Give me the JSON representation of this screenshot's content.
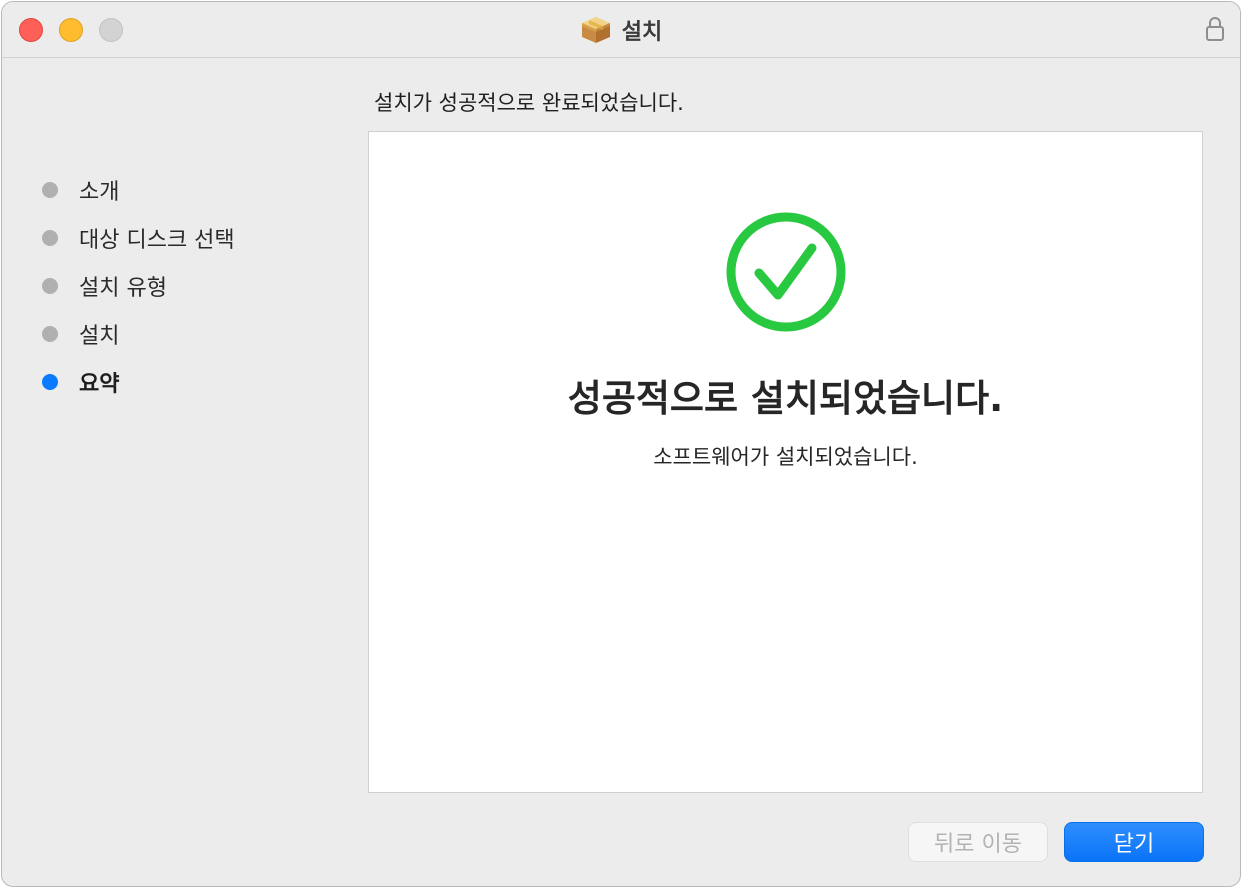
{
  "window": {
    "title": "설치",
    "icons": {
      "title_icon": "package-icon",
      "lock": "lock-icon"
    }
  },
  "sidebar": {
    "steps": [
      {
        "label": "소개",
        "state": "done"
      },
      {
        "label": "대상 디스크 선택",
        "state": "done"
      },
      {
        "label": "설치 유형",
        "state": "done"
      },
      {
        "label": "설치",
        "state": "done"
      },
      {
        "label": "요약",
        "state": "current"
      }
    ]
  },
  "main": {
    "header": "설치가 성공적으로 완료되었습니다.",
    "status_icon": "checkmark-circle-icon",
    "success_title": "성공적으로 설치되었습니다.",
    "success_subtitle": "소프트웨어가 설치되었습니다."
  },
  "buttons": {
    "back_label": "뒤로 이동",
    "back_enabled": false,
    "close_label": "닫기"
  },
  "colors": {
    "accent": "#0a7aff",
    "success": "#28c840",
    "step_dot": "#b0b0b0"
  }
}
